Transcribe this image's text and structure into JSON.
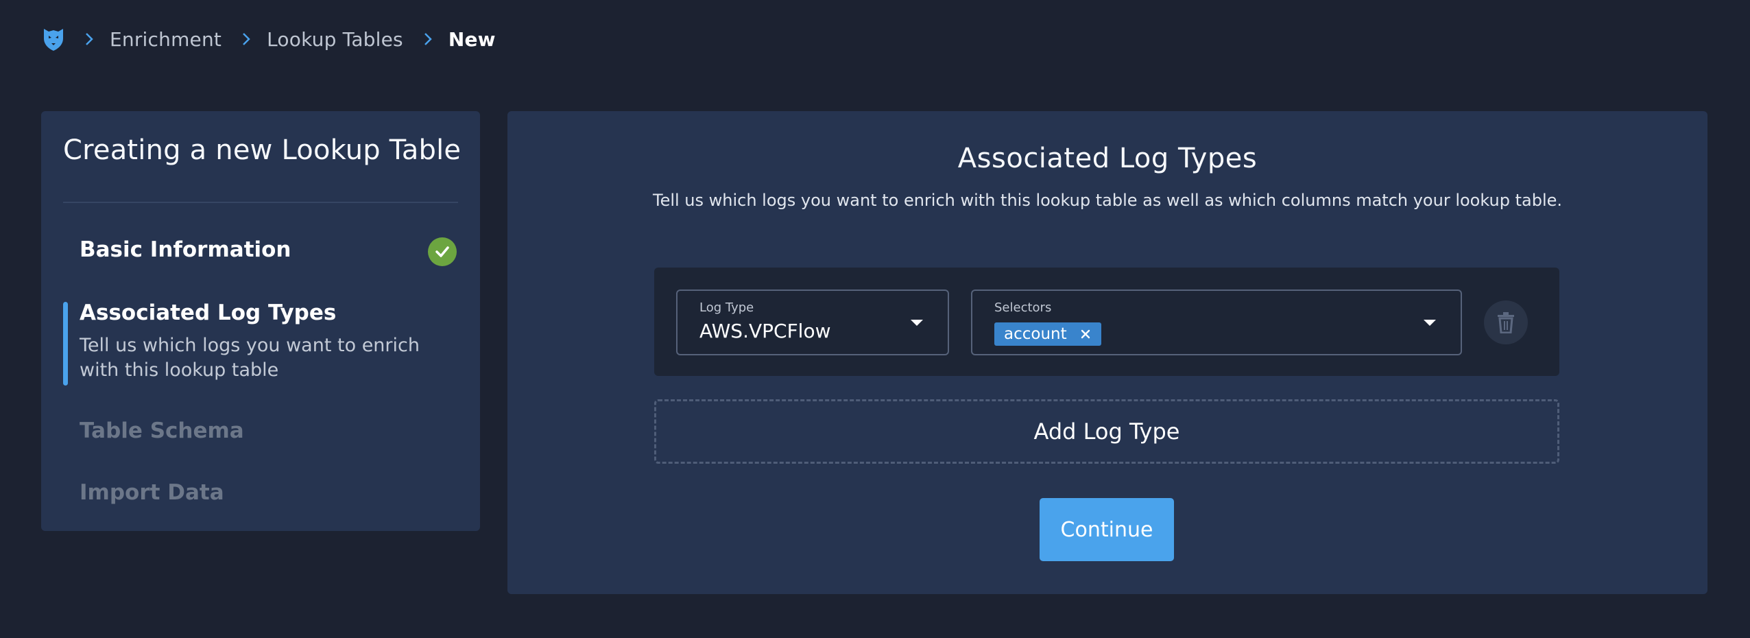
{
  "colors": {
    "background": "#1c2231",
    "panel": "#263450",
    "accent": "#4aa3ec",
    "success": "#6ca540",
    "chip": "#3984cc"
  },
  "breadcrumb": {
    "logo_icon": "panther-logo-icon",
    "items": [
      "Enrichment",
      "Lookup Tables"
    ],
    "current": "New"
  },
  "sidebar": {
    "title": "Creating a new Lookup Table",
    "steps": [
      {
        "title": "Basic Information",
        "status": "complete",
        "icon": "check-circle-icon"
      },
      {
        "title": "Associated Log Types",
        "status": "active",
        "description": "Tell us which logs you want to enrich with this lookup table"
      },
      {
        "title": "Table Schema",
        "status": "pending"
      },
      {
        "title": "Import Data",
        "status": "pending"
      }
    ]
  },
  "main": {
    "title": "Associated Log Types",
    "subtitle": "Tell us which logs you want to enrich with this lookup table as well as which columns match your lookup table.",
    "log_type_field": {
      "label": "Log Type",
      "value": "AWS.VPCFlow"
    },
    "selectors_field": {
      "label": "Selectors",
      "chips": [
        "account"
      ]
    },
    "add_log_type_label": "Add Log Type",
    "continue_label": "Continue"
  }
}
